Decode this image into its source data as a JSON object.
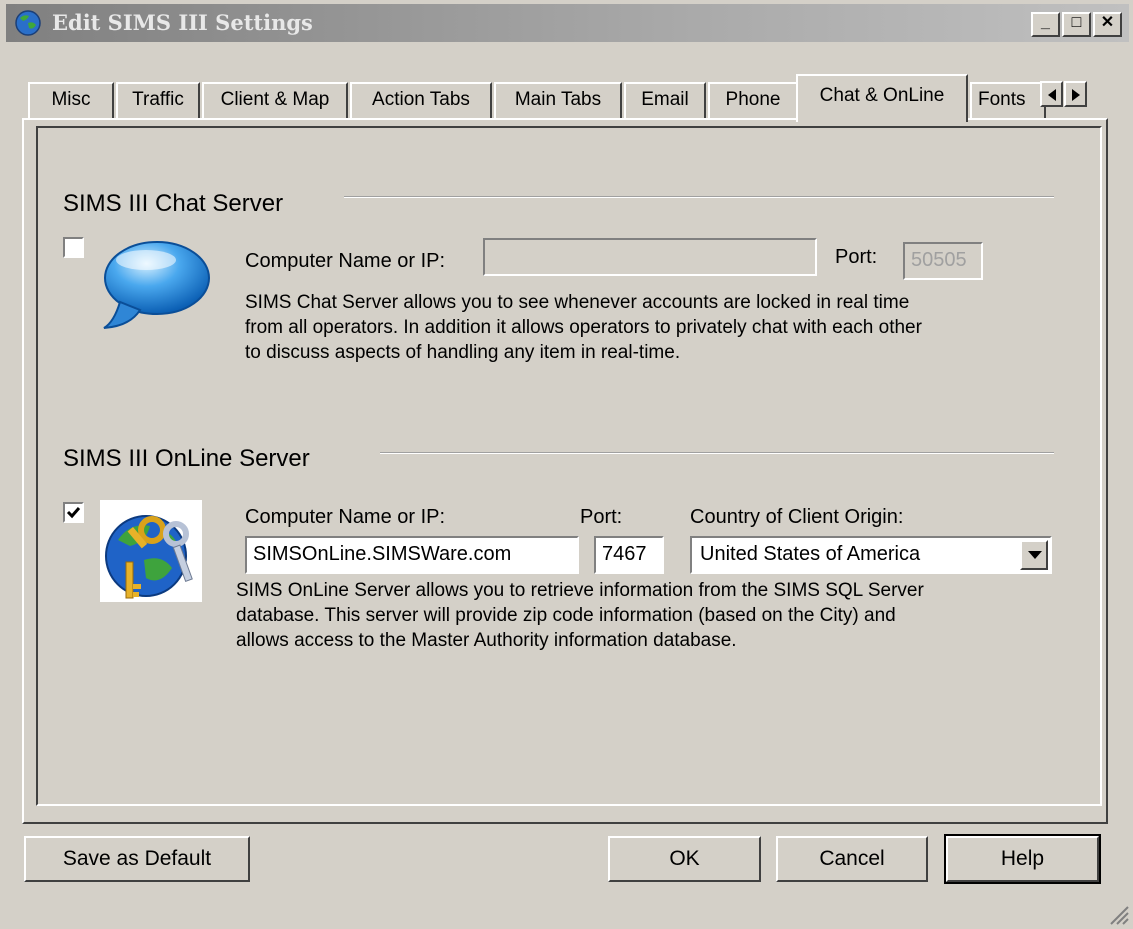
{
  "window": {
    "title": "Edit SIMS III Settings",
    "min_glyph": "_",
    "max_glyph": "□",
    "close_glyph": "✕"
  },
  "tabs": [
    {
      "label": "Misc",
      "active": false
    },
    {
      "label": "Traffic",
      "active": false
    },
    {
      "label": "Client & Map",
      "active": false
    },
    {
      "label": "Action Tabs",
      "active": false
    },
    {
      "label": "Main Tabs",
      "active": false
    },
    {
      "label": "Email",
      "active": false
    },
    {
      "label": "Phone",
      "active": false
    },
    {
      "label": "Chat & OnLine",
      "active": true
    },
    {
      "label": "Fonts",
      "active": false
    }
  ],
  "chat_server": {
    "title": "SIMS III Chat Server",
    "enabled": false,
    "computer_label": "Computer Name or IP:",
    "computer_value": "",
    "port_label": "Port:",
    "port_value": "50505",
    "description": [
      "SIMS Chat Server allows you to see whenever accounts are locked in real time",
      "from all operators. In addition it allows operators to privately chat with each other",
      "to discuss aspects of handling any item in real-time."
    ]
  },
  "online_server": {
    "title": "SIMS III OnLine Server",
    "enabled": true,
    "computer_label": "Computer Name or IP:",
    "computer_value": "SIMSOnLine.SIMSWare.com",
    "port_label": "Port:",
    "port_value": "7467",
    "country_label": "Country of Client Origin:",
    "country_value": "United States of America",
    "description": [
      "SIMS OnLine Server allows you to retrieve information from the SIMS SQL Server",
      "database.  This server will provide zip code information (based on the City) and",
      "allows access to the Master Authority information database."
    ]
  },
  "buttons": {
    "save_default": "Save as Default",
    "ok": "OK",
    "cancel": "Cancel",
    "help": "Help"
  },
  "colors": {
    "dialog_bg": "#d4d0c8",
    "titlebar_inactive": "#808080"
  },
  "icons": [
    "app-globe-icon",
    "chat-bubble-icon",
    "globe-keys-icon",
    "checkmark-icon",
    "dropdown-arrow-icon",
    "resize-grip-icon"
  ]
}
